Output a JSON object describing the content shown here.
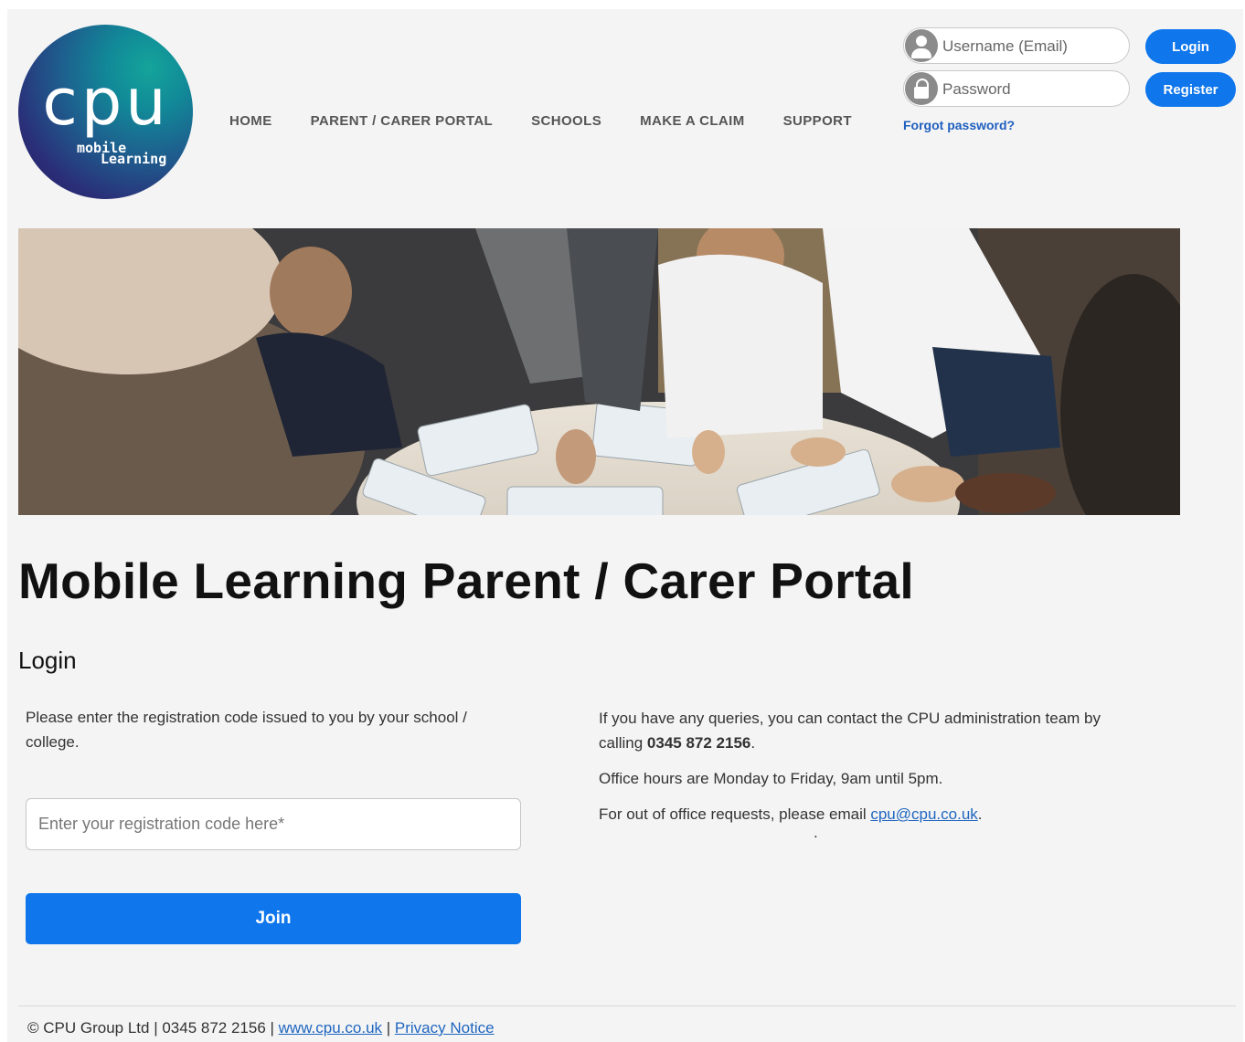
{
  "logo": {
    "main": "cpu",
    "line1": "mobile",
    "line2": "Learning"
  },
  "nav": [
    {
      "label": "HOME"
    },
    {
      "label": "PARENT / CARER PORTAL"
    },
    {
      "label": "SCHOOLS"
    },
    {
      "label": "MAKE A CLAIM"
    },
    {
      "label": "SUPPORT"
    }
  ],
  "header_login": {
    "username_placeholder": "Username (Email)",
    "password_placeholder": "Password",
    "login_label": "Login",
    "register_label": "Register",
    "forgot_label": "Forgot password?"
  },
  "hero": {
    "icon": "classroom-photo"
  },
  "page_title": "Mobile Learning Parent / Carer Portal",
  "section_title": "Login",
  "intro_text": "Please enter the registration code issued to you by your school / college.",
  "registration": {
    "placeholder": "Enter your registration code here*",
    "join_label": "Join"
  },
  "info": {
    "line1_prefix": "If you have any queries, you can contact the CPU administration team by calling ",
    "phone": "0345 872 2156",
    "line1_suffix": ".",
    "hours": "Office hours are Monday to Friday, 9am until 5pm.",
    "email_prefix": "For out of office requests, please email ",
    "email": "cpu@cpu.co.uk",
    "email_suffix": ".",
    "dot": "."
  },
  "footer": {
    "prefix": "© CPU Group Ltd | 0345 872 2156 | ",
    "website": "www.cpu.co.uk",
    "sep": " | ",
    "privacy": "Privacy Notice"
  },
  "colors": {
    "accent": "#0f76ec",
    "link": "#1f66c0",
    "background": "#f4f4f4"
  }
}
